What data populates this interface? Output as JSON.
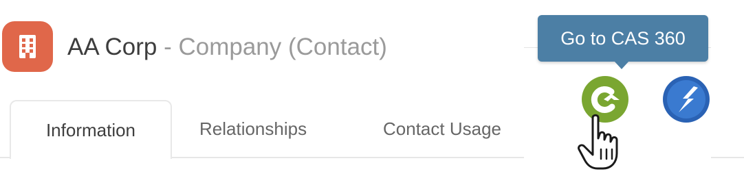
{
  "record": {
    "icon": "building-icon",
    "name": "AA Corp",
    "separator": "-",
    "type": "Company (Contact)",
    "icon_color": "#e0674a"
  },
  "tabs": [
    {
      "label": "Information",
      "active": true
    },
    {
      "label": "Relationships",
      "active": false
    },
    {
      "label": "Contact Usage",
      "active": false
    }
  ],
  "tooltip": {
    "text": "Go to CAS 360",
    "color": "#4c7fa5"
  },
  "apps": [
    {
      "icon": "cas360-icon",
      "color": "#7aa631"
    },
    {
      "icon": "linked-app-icon",
      "color": "#2a62b4"
    }
  ],
  "cursor": {
    "icon": "hand-pointer-icon"
  }
}
